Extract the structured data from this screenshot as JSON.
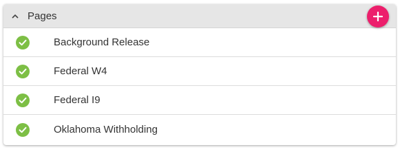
{
  "header": {
    "title": "Pages",
    "toggle_icon": "chevron-up-icon",
    "add_icon": "plus-icon",
    "add_button_color": "#ec1f6c"
  },
  "pages": [
    {
      "label": "Background Release",
      "status": "complete",
      "status_icon": "check-circle-icon"
    },
    {
      "label": "Federal W4",
      "status": "complete",
      "status_icon": "check-circle-icon"
    },
    {
      "label": "Federal I9",
      "status": "complete",
      "status_icon": "check-circle-icon"
    },
    {
      "label": "Oklahoma Withholding",
      "status": "complete",
      "status_icon": "check-circle-icon"
    }
  ],
  "colors": {
    "complete": "#7dbf45",
    "header_background": "#e6e6e6"
  }
}
